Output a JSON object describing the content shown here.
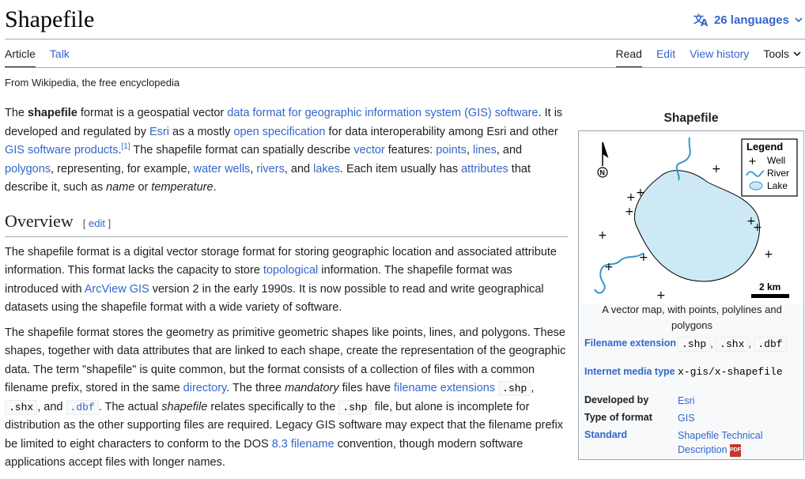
{
  "page": {
    "title": "Shapefile",
    "languages": "26 languages",
    "tagline": "From Wikipedia, the free encyclopedia"
  },
  "tabs": {
    "article": "Article",
    "talk": "Talk",
    "read": "Read",
    "edit": "Edit",
    "history": "View history",
    "tools": "Tools"
  },
  "intro": {
    "p1_a": "The ",
    "p1_bold": "shapefile",
    "p1_b": " format is a geospatial vector ",
    "p1_link1": "data format for geographic information system (GIS) software",
    "p1_c": ". It is developed and regulated by ",
    "p1_link2": "Esri",
    "p1_d": " as a mostly ",
    "p1_link3": "open specification",
    "p1_e": " for data interoperability among Esri and other ",
    "p1_link4": "GIS software products",
    "p1_ref": "[1]",
    "p1_f": " The shapefile format can spatially describe ",
    "p1_link5": "vector",
    "p1_g": " features: ",
    "p1_link6": "points",
    "p1_h": ", ",
    "p1_link7": "lines",
    "p1_i": ", and ",
    "p1_link8": "polygons",
    "p1_j": ", representing, for example, ",
    "p1_link9": "water wells",
    "p1_k": ", ",
    "p1_link10": "rivers",
    "p1_l": ", and ",
    "p1_link11": "lakes",
    "p1_m": ". Each item usually has ",
    "p1_link12": "attributes",
    "p1_n": " that describe it, such as ",
    "p1_it1": "name",
    "p1_o": " or ",
    "p1_it2": "temperature",
    "p1_p": "."
  },
  "overview": {
    "heading": "Overview",
    "edit_open": "[ ",
    "edit_label": "edit",
    "edit_close": " ]",
    "p1_a": "The shapefile format is a digital vector storage format for storing geographic location and associated attribute information. This format lacks the capacity to store ",
    "p1_link1": "topological",
    "p1_b": " information. The shapefile format was introduced with ",
    "p1_link2": "ArcView GIS",
    "p1_c": " version 2 in the early 1990s. It is now possible to read and write geographical datasets using the shapefile format with a wide variety of software.",
    "p2_a": "The shapefile format stores the geometry as primitive geometric shapes like points, lines, and polygons. These shapes, together with data attributes that are linked to each shape, create the representation of the geographic data. The term \"shapefile\" is quite common, but the format consists of a collection of files with a common filename prefix, stored in the same ",
    "p2_link1": "directory",
    "p2_b": ". The three ",
    "p2_it1": "mandatory",
    "p2_c": " files have ",
    "p2_link2": "filename extensions",
    "p2_code1": ".shp",
    "p2_d": ", ",
    "p2_code2": ".shx",
    "p2_e": ", and ",
    "p2_code3": ".dbf",
    "p2_f": ". The actual ",
    "p2_it2": "shapefile",
    "p2_g": " relates specifically to the ",
    "p2_code4": ".shp",
    "p2_h": " file, but alone is incomplete for distribution as the other supporting files are required. Legacy GIS software may expect that the filename prefix be limited to eight characters to conform to the DOS ",
    "p2_link3": "8.3 filename",
    "p2_i": " convention, though modern software applications accept files with longer names."
  },
  "infobox": {
    "title": "Shapefile",
    "legend_title": "Legend",
    "legend_well": "Well",
    "legend_river": "River",
    "legend_lake": "Lake",
    "north_label": "N",
    "scale_label": "2 km",
    "caption": "A vector map, with points, polylines and polygons",
    "row1_label": "Filename extension",
    "row1_v1": ".shp",
    "row1_v2": ".shx",
    "row1_v3": ".dbf",
    "row2_label": "Internet media type",
    "row2_value": "x-gis/x-shapefile",
    "row3_label": "Developed by",
    "row3_value": "Esri",
    "row4_label": "Type of format",
    "row4_value": "GIS",
    "row5_label": "Standard",
    "row5_value": "Shapefile Technical Description",
    "pdf_label": "PDF"
  },
  "colors": {
    "link": "#3366cc",
    "lake_fill": "#cde9f6",
    "river": "#3399cc"
  },
  "icons": [
    "translate-icon",
    "chevron-down-icon",
    "north-arrow-icon",
    "pdf-icon",
    "well-icon",
    "river-icon",
    "lake-icon"
  ]
}
